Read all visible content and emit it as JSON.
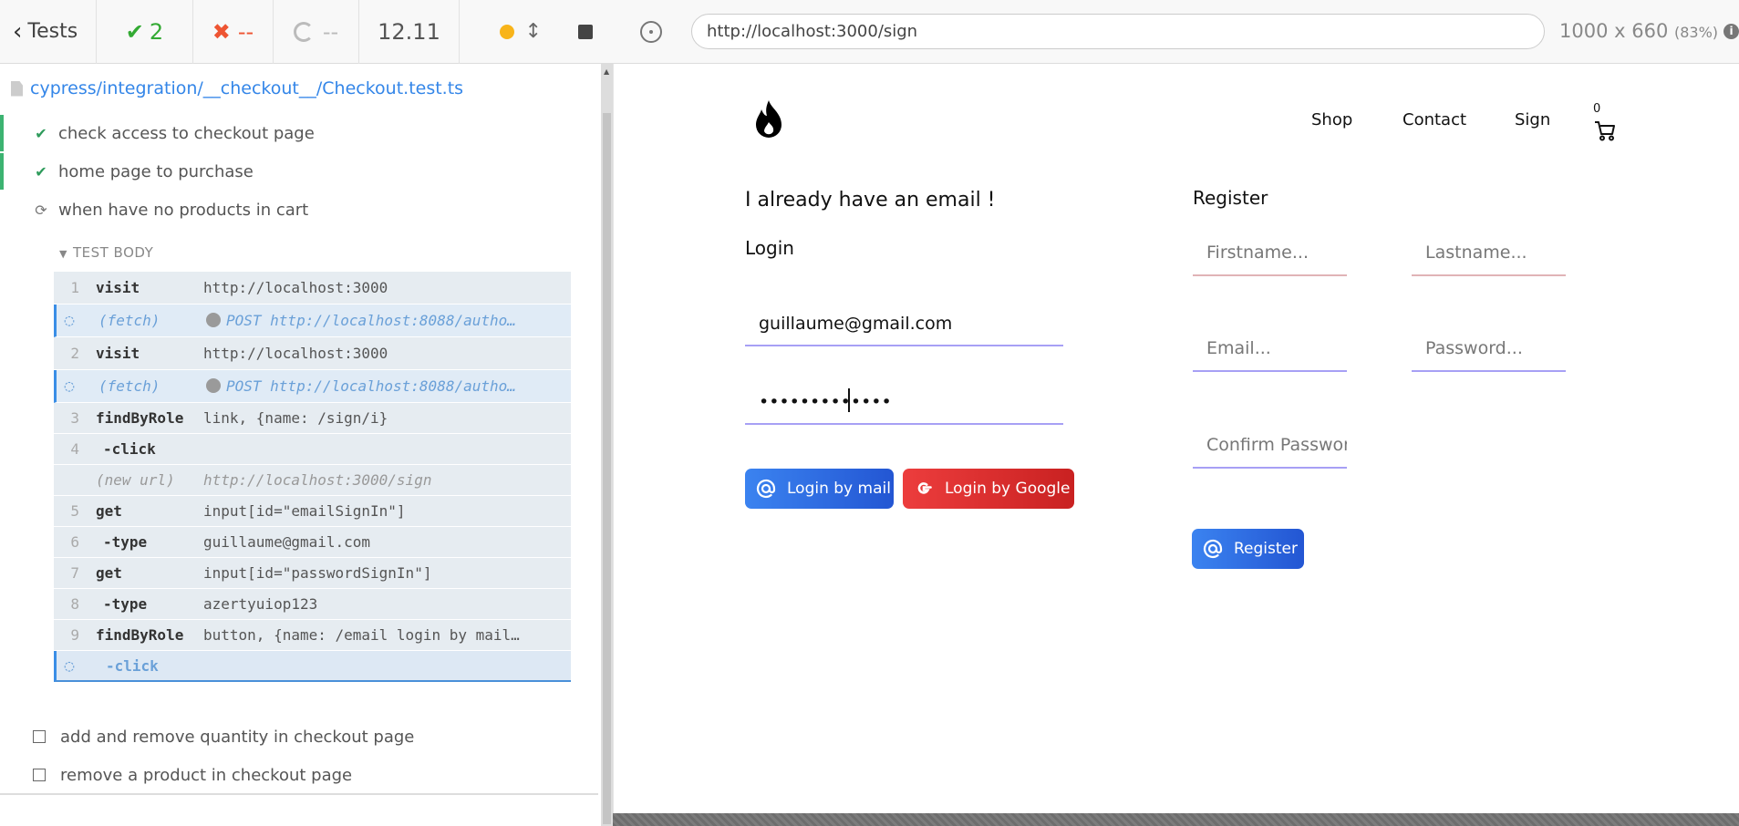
{
  "runner": {
    "back_label": "Tests",
    "passed_count": "2",
    "failed_count": "--",
    "pending_count": "--",
    "duration": "12.11",
    "spec_path": "cypress/integration/__checkout__/Checkout.test.ts",
    "tests": [
      {
        "title": "check access to checkout page",
        "state": "passed"
      },
      {
        "title": "home page to purchase",
        "state": "passed"
      },
      {
        "title": "when have no products in cart",
        "state": "running"
      },
      {
        "title": "add and remove quantity in checkout page",
        "state": "pending"
      },
      {
        "title": "remove a product in checkout page",
        "state": "pending"
      }
    ],
    "test_body_label": "TEST BODY",
    "commands": [
      {
        "num": "1",
        "name": "visit",
        "message": "http://localhost:3000"
      },
      {
        "num": "",
        "name": "(fetch)",
        "message": "POST http://localhost:8088/autho…"
      },
      {
        "num": "2",
        "name": "visit",
        "message": "http://localhost:3000"
      },
      {
        "num": "",
        "name": "(fetch)",
        "message": "POST http://localhost:8088/autho…"
      },
      {
        "num": "3",
        "name": "findByRole",
        "message": "link, {name: /sign/i}"
      },
      {
        "num": "4",
        "name": "-click",
        "message": ""
      },
      {
        "num": "",
        "name": "(new url)",
        "message": "http://localhost:3000/sign"
      },
      {
        "num": "5",
        "name": "get",
        "message": "input[id=\"emailSignIn\"]"
      },
      {
        "num": "6",
        "name": "-type",
        "message": "guillaume@gmail.com"
      },
      {
        "num": "7",
        "name": "get",
        "message": "input[id=\"passwordSignIn\"]"
      },
      {
        "num": "8",
        "name": "-type",
        "message": "azertyuiop123"
      },
      {
        "num": "9",
        "name": "findByRole",
        "message": "button, {name: /email login by mail…"
      },
      {
        "num": "",
        "name": "-click",
        "message": ""
      }
    ]
  },
  "aut": {
    "url": "http://localhost:3000/sign",
    "viewport": "1000 x 660",
    "scale": "(83%)",
    "nav": {
      "shop": "Shop",
      "contact": "Contact",
      "sign": "Sign",
      "cart_count": "0"
    },
    "login": {
      "heading": "I already have an email !",
      "subheading": "Login",
      "email_value": "guillaume@gmail.com",
      "password_value": "azertyuiop123",
      "mail_button": "Login by mail",
      "google_button": "Login by Google"
    },
    "register": {
      "heading": "Register",
      "firstname_placeholder": "Firstname...",
      "lastname_placeholder": "Lastname...",
      "email_placeholder": "Email...",
      "password_placeholder": "Password...",
      "confirm_placeholder": "Confirm Password...",
      "button": "Register"
    },
    "colors": {
      "primary": "#2f6fe4",
      "google": "#dc2f2f",
      "passed": "#2e9b5b",
      "failed": "#e53",
      "running_dot": "#f8b41a"
    }
  }
}
